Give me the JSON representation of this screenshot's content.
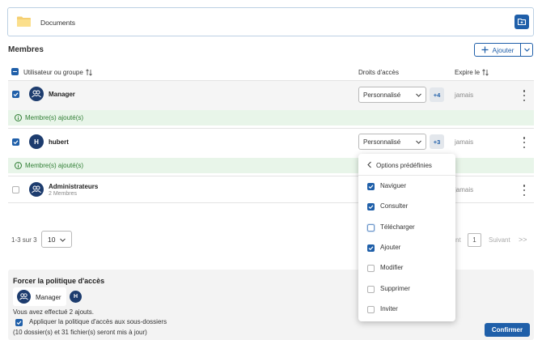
{
  "folder": {
    "name": "Documents"
  },
  "members": {
    "title": "Membres",
    "add_label": "Ajouter",
    "columns": {
      "user": "Utilisateur ou groupe",
      "rights": "Droits d'accès",
      "expires": "Expire le"
    },
    "rows": [
      {
        "name": "Manager",
        "subtitle": "",
        "avatar": "group",
        "checked": true,
        "rights": "Personnalisé",
        "extra": "+4",
        "expires": "jamais"
      },
      {
        "name": "hubert",
        "subtitle": "",
        "avatar": "H",
        "checked": true,
        "rights": "Personnalisé",
        "extra": "+3",
        "expires": "jamais"
      },
      {
        "name": "Administrateurs",
        "subtitle": "2 Membres",
        "avatar": "group",
        "checked": false,
        "rights": "",
        "extra": "",
        "expires": "jamais"
      }
    ],
    "added_notice": "Membre(s) ajouté(s)"
  },
  "pager": {
    "info": "1-3 sur 3",
    "page_size": "10",
    "previous": "nt",
    "page": "1",
    "next": "Suivant",
    "last": ">>"
  },
  "dropdown": {
    "title": "Options prédéfinies",
    "options": [
      {
        "label": "Naviguer",
        "checked": true
      },
      {
        "label": "Consulter",
        "checked": true
      },
      {
        "label": "Télécharger",
        "checked": false
      },
      {
        "label": "Ajouter",
        "checked": true
      },
      {
        "label": "Modifier",
        "checked": false
      },
      {
        "label": "Supprimer",
        "checked": false
      },
      {
        "label": "Inviter",
        "checked": false
      }
    ]
  },
  "policy": {
    "title": "Forcer la politique d'accès",
    "chip_label": "Manager",
    "second_avatar": "H",
    "summary": "Vous avez effectué 2 ajouts.",
    "apply_label": "Appliquer la politique d'accès aux sous-dossiers",
    "apply_checked": true,
    "note": "(10 dossier(s) et 31 fichier(s) seront mis à jour)",
    "confirm_label": "Confirmer"
  },
  "colors": {
    "primary": "#1f5fa9",
    "avatar": "#1d3c6e",
    "success_bg": "#e8f5e9",
    "success_text": "#2e7d32"
  }
}
